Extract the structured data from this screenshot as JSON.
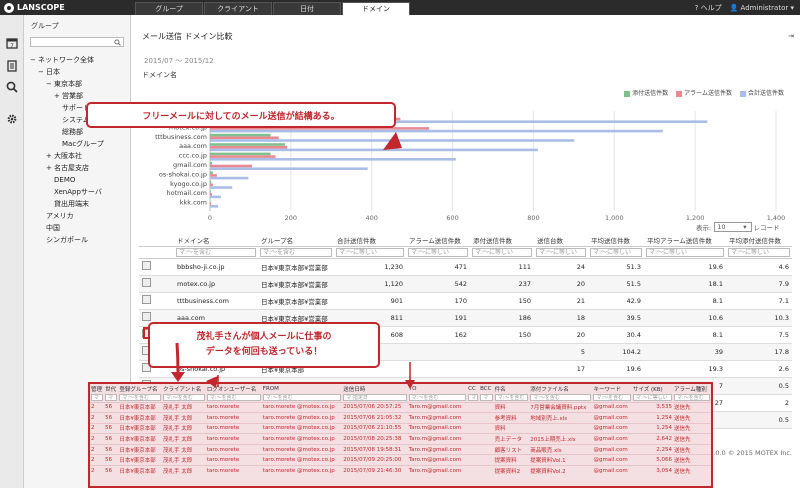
{
  "app": {
    "logo": "LANSCOPE",
    "help": "ヘルプ",
    "user": "Administrator"
  },
  "tabs": [
    {
      "label": "グループ",
      "active": false
    },
    {
      "label": "クライアント",
      "active": false
    },
    {
      "label": "日付",
      "active": false
    },
    {
      "label": "ドメイン",
      "active": true
    }
  ],
  "sidebar": {
    "icons": [
      "calendar-icon",
      "notebook-icon",
      "search-icon",
      "gear-icon"
    ]
  },
  "tree": {
    "header": "グループ",
    "search_value": "",
    "items": [
      {
        "label": "ネットワーク全体",
        "toggle": "−",
        "level": 0
      },
      {
        "label": "日本",
        "toggle": "−",
        "level": 1
      },
      {
        "label": "東京本部",
        "toggle": "−",
        "level": 2
      },
      {
        "label": "営業部",
        "toggle": "+",
        "level": 3
      },
      {
        "label": "サポート部",
        "toggle": "",
        "level": 3
      },
      {
        "label": "システム部",
        "toggle": "",
        "level": 3
      },
      {
        "label": "総務部",
        "toggle": "",
        "level": 3
      },
      {
        "label": "Macグループ",
        "toggle": "",
        "level": 3
      },
      {
        "label": "大阪本社",
        "toggle": "+",
        "level": 2
      },
      {
        "label": "名古屋支店",
        "toggle": "+",
        "level": 2
      },
      {
        "label": "DEMO",
        "toggle": "",
        "level": 2
      },
      {
        "label": "XenAppサーバ",
        "toggle": "",
        "level": 2
      },
      {
        "label": "貸出用端末",
        "toggle": "",
        "level": 2
      },
      {
        "label": "アメリカ",
        "toggle": "",
        "level": 1
      },
      {
        "label": "中国",
        "toggle": "",
        "level": 1
      },
      {
        "label": "シンガポール",
        "toggle": "",
        "level": 1
      }
    ]
  },
  "main": {
    "title": "メール送信 ドメイン比較",
    "date_range": "2015/07 〜 2015/12",
    "perpage_label": "表示:",
    "perpage_value": "10",
    "record_label": "レコード",
    "footer": "3.3.0.0 © 2015 MOTEX Inc."
  },
  "colors": {
    "attach": "#7fc08c",
    "alarm": "#e98a92",
    "total": "#a9bde8",
    "accent": "#c1272d"
  },
  "chart_data": {
    "type": "bar",
    "orientation": "horizontal",
    "ylabel": "ドメイン名",
    "categories": [
      "bbbsho-ji.co.jp",
      "motex.co.jp",
      "tttbusiness.com",
      "aaa.com",
      "ccc.co.jp",
      "gmail.com",
      "os-shokai.co.jp",
      "kyogo.co.jp",
      "hotmail.com",
      "kkk.com"
    ],
    "series": [
      {
        "name": "添付送信件数",
        "color": "#7fc08c",
        "values": [
          111,
          237,
          150,
          186,
          150,
          5,
          7,
          3,
          2,
          1
        ]
      },
      {
        "name": "アラーム送信件数",
        "color": "#e98a92",
        "values": [
          471,
          542,
          170,
          191,
          162,
          104,
          17,
          7,
          5,
          3
        ]
      },
      {
        "name": "合計送信件数",
        "color": "#a9bde8",
        "values": [
          1230,
          1120,
          901,
          811,
          608,
          390,
          95,
          55,
          27,
          20
        ]
      }
    ],
    "xticks": [
      "0",
      "200",
      "400",
      "600",
      "800",
      "1,000",
      "1,200",
      "1,400"
    ],
    "xlim": [
      0,
      1400
    ],
    "legend": "top-right",
    "annotation": "フリーメールに対してのメール送信が結構ある。"
  },
  "table": {
    "headers": [
      "ドメイン名",
      "グループ名",
      "合計送信件数",
      "アラーム送信件数",
      "添付送信件数",
      "送信台数",
      "平均送信件数",
      "平均アラーム送信件数",
      "平均添付送信件数"
    ],
    "filters": [
      "マ:〜を含む",
      "マ:〜を含む",
      "マ:〜に等しい",
      "マ:〜に等しい",
      "マ:〜に等しい",
      "マ:〜に等しい",
      "マ:〜に等しい",
      "マ:〜に等しい",
      "マ:〜に等しい"
    ],
    "rows": [
      [
        "bbbsho-ji.co.jp",
        "日本¥東京本部¥営業部",
        "1,230",
        "471",
        "111",
        "24",
        "51.3",
        "19.6",
        "4.6"
      ],
      [
        "motex.co.jp",
        "日本¥東京本部¥営業部",
        "1,120",
        "542",
        "237",
        "20",
        "51.5",
        "18.1",
        "7.9"
      ],
      [
        "tttbusiness.com",
        "日本¥東京本部¥営業部",
        "901",
        "170",
        "150",
        "21",
        "42.9",
        "8.1",
        "7.1"
      ],
      [
        "aaa.com",
        "日本¥東京本部¥営業部",
        "811",
        "191",
        "186",
        "18",
        "39.5",
        "10.6",
        "10.3"
      ],
      [
        "ccc.co.jp",
        "日本¥東京本部¥営業部",
        "608",
        "162",
        "150",
        "20",
        "30.4",
        "8.1",
        "7.5"
      ],
      [
        "gmail.com",
        "日本¥東京本部",
        "",
        "",
        "",
        "5",
        "104.2",
        "39",
        "17.8"
      ],
      [
        "os-shokai.co.jp",
        "日本¥東京本部",
        "",
        "",
        "",
        "17",
        "19.6",
        "19.3",
        "2.6"
      ],
      [
        "kyogo.co.jp",
        "日本¥東京本部",
        "",
        "",
        "",
        "",
        "",
        "7",
        "0.5"
      ],
      [
        "hotmail.com",
        "日本¥東京本部",
        "",
        "",
        "",
        "",
        "",
        "27",
        "2"
      ],
      [
        "kkk.com",
        "日本¥東京本部",
        "",
        "",
        "",
        "",
        "",
        "",
        "0.5"
      ]
    ]
  },
  "callout2": {
    "line1": "茂礼手さんが個人メールに仕事の",
    "line2": "データを何回も送っている！"
  },
  "overlay": {
    "headers": [
      "管理",
      "世代",
      "登録グループ名",
      "クライアント名",
      "ログオンユーザー名",
      "FROM",
      "送信日時",
      "TO",
      "CC",
      "BCC",
      "件名",
      "添付ファイル名",
      "キーワード",
      "サイズ (KB)",
      "アラーム種別"
    ],
    "filters": [
      "マ",
      "マ",
      "マ:〜を含む",
      "マ:〜を含む",
      "マ:〜を含む",
      "マ:〜を含む",
      "マ:指定日",
      "マ:〜を含む",
      "マ",
      "マ",
      "マ:〜を含む",
      "マ:〜を含む",
      "マ:〜を含む",
      "マ:〜に等しい",
      "マ:〜を含む"
    ],
    "rows": [
      [
        "2",
        "56",
        "日本¥東京本部",
        "茂礼手 太郎",
        "taro.morete",
        "taro.morete @motex.co.jp",
        "2015/07/06 20:57:25",
        "Taro.m@gmail.com",
        "",
        "",
        "資料",
        "7月営業会議資料.pptx",
        "@gmail.com",
        "3,535",
        "送信先"
      ],
      [
        "2",
        "56",
        "日本¥東京本部",
        "茂礼手 太郎",
        "taro.morete",
        "taro.morete @motex.co.jp",
        "2015/07/06 21:05:32",
        "Taro.m@gmail.com",
        "",
        "",
        "参考資料",
        "地域別売上.xls",
        "@gmail.com",
        "1,254",
        "送信先"
      ],
      [
        "2",
        "56",
        "日本¥東京本部",
        "茂礼手 太郎",
        "taro.morete",
        "taro.morete @motex.co.jp",
        "2015/07/06 21:10:55",
        "Taro.m@gmail.com",
        "",
        "",
        "資料",
        "",
        "@gmail.com",
        "1,254",
        "送信先"
      ],
      [
        "2",
        "56",
        "日本¥東京本部",
        "茂礼手 太郎",
        "taro.morete",
        "taro.morete @motex.co.jp",
        "2015/07/08 20:25:38",
        "Taro.m@gmail.com",
        "",
        "",
        "売上データ",
        "2015上期売上.xls",
        "@gmail.com",
        "2,642",
        "送信先"
      ],
      [
        "2",
        "56",
        "日本¥東京本部",
        "茂礼手 太郎",
        "taro.morete",
        "taro.morete @motex.co.jp",
        "2015/07/08 19:58:31",
        "Taro.m@gmail.com",
        "",
        "",
        "顧客リスト",
        "商品販売.xls",
        "@gmail.com",
        "2,254",
        "送信先"
      ],
      [
        "2",
        "56",
        "日本¥東京本部",
        "茂礼手 太郎",
        "taro.morete",
        "taro.morete @motex.co.jp",
        "2015/07/09 20:25:00",
        "Taro.m@gmail.com",
        "",
        "",
        "提案資料",
        "提案資料Vol.1",
        "@gmail.com",
        "5,066",
        "送信先"
      ],
      [
        "2",
        "56",
        "日本¥東京本部",
        "茂礼手 太郎",
        "taro.morete",
        "taro.morete @motex.co.jp",
        "2015/07/09 21:46:30",
        "Taro.m@gmail.com",
        "",
        "",
        "提案資料2",
        "提案資料Vol.2",
        "@gmail.com",
        "3,054",
        "送信先"
      ]
    ]
  }
}
